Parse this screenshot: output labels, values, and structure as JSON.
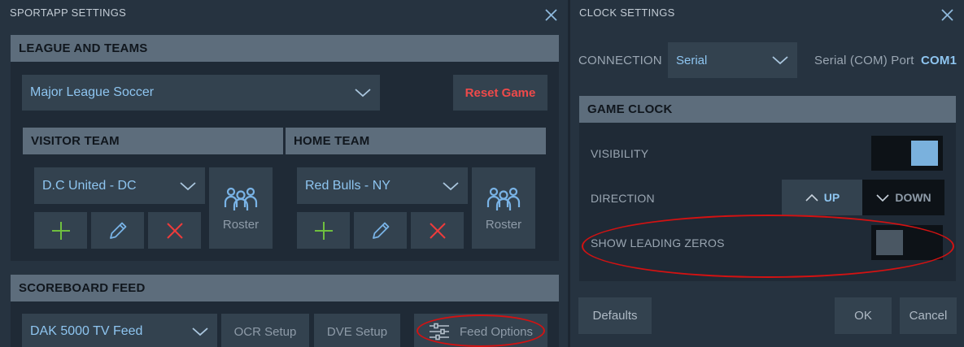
{
  "sportapp": {
    "title": "SPORTAPP SETTINGS",
    "league_section": "LEAGUE AND TEAMS",
    "league_value": "Major League Soccer",
    "reset_label": "Reset Game",
    "visitor": {
      "header": "VISITOR TEAM",
      "team_value": "D.C United - DC",
      "roster_label": "Roster"
    },
    "home": {
      "header": "HOME TEAM",
      "team_value": "Red Bulls - NY",
      "roster_label": "Roster"
    },
    "feed_section": "SCOREBOARD FEED",
    "feed_value": "DAK 5000 TV Feed",
    "ocr_label": "OCR Setup",
    "dve_label": "DVE Setup",
    "feed_options_label": "Feed Options"
  },
  "clock": {
    "title": "CLOCK SETTINGS",
    "connection_label": "CONNECTION",
    "connection_value": "Serial",
    "port_label": "Serial (COM) Port",
    "port_value": "COM1",
    "game_clock_section": "GAME CLOCK",
    "visibility_label": "VISIBILITY",
    "visibility_on": true,
    "direction_label": "DIRECTION",
    "direction_up": "UP",
    "direction_down": "DOWN",
    "direction_selected": "UP",
    "leading_zeros_label": "SHOW LEADING ZEROS",
    "leading_zeros_on": false,
    "defaults_label": "Defaults",
    "ok_label": "OK",
    "cancel_label": "Cancel"
  },
  "colors": {
    "panel": "#263340",
    "section_bar": "#5d6d7c",
    "accent_blue": "#8ec5f0",
    "reset_red": "#ef4a4a",
    "add_green": "#6fbf3f",
    "delete_red": "#ee3b3b",
    "annotation_red": "#d31212"
  }
}
